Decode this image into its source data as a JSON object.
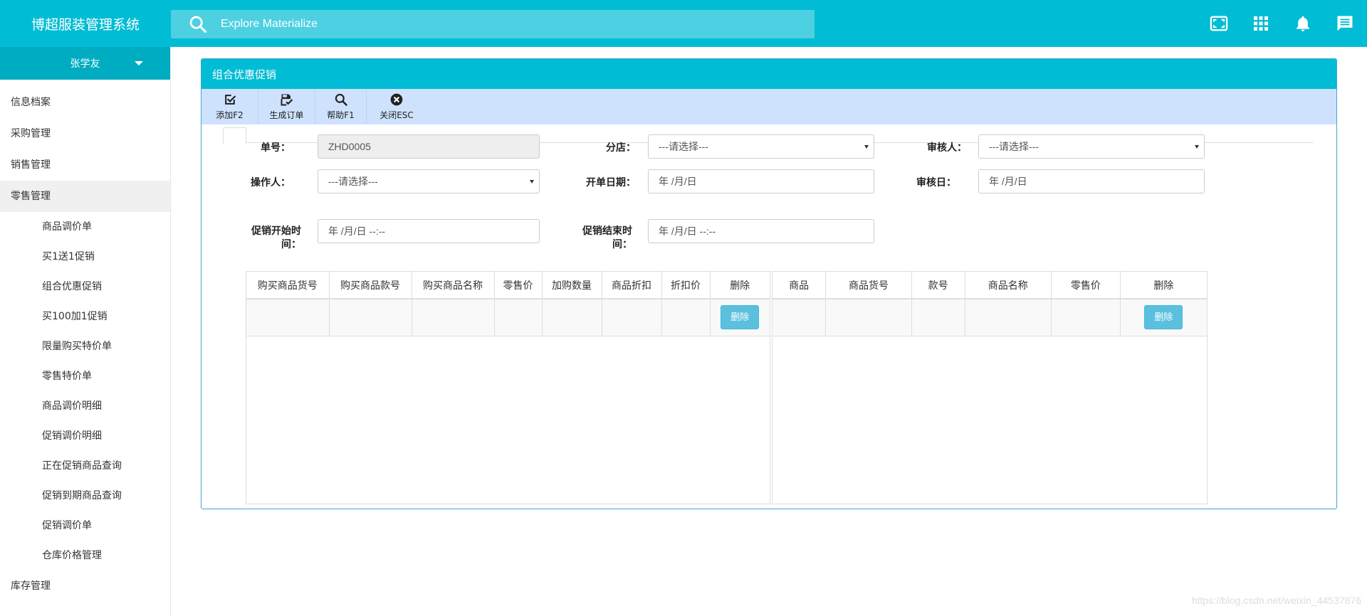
{
  "app": {
    "title": "博超服装管理系统",
    "search_placeholder": "Explore Materialize",
    "top_icons": [
      "fullscreen-icon",
      "apps-grid-icon",
      "notifications-bell-icon",
      "chat-message-icon"
    ]
  },
  "sidebar": {
    "user": "张学友",
    "nav": [
      {
        "label": "信息档案"
      },
      {
        "label": "采购管理"
      },
      {
        "label": "销售管理"
      },
      {
        "label": "零售管理"
      }
    ],
    "sub": [
      {
        "label": "商品调价单"
      },
      {
        "label": "买1送1促销"
      },
      {
        "label": "组合优惠促销"
      },
      {
        "label": "买100加1促销"
      },
      {
        "label": "限量购买特价单"
      },
      {
        "label": "零售特价单"
      },
      {
        "label": "商品调价明细"
      },
      {
        "label": "促销调价明细"
      },
      {
        "label": "正在促销商品查询"
      },
      {
        "label": "促销到期商品查询"
      },
      {
        "label": "促销调价单"
      },
      {
        "label": "仓库价格管理"
      }
    ],
    "after": [
      {
        "label": "库存管理"
      }
    ]
  },
  "panel": {
    "title": "组合优惠促销",
    "toolbar": [
      {
        "label": "添加F2",
        "icon": "check-square-icon"
      },
      {
        "label": "生成订单",
        "icon": "save-check-icon"
      },
      {
        "label": "帮助F1",
        "icon": "search-icon"
      },
      {
        "label": "关闭ESC",
        "icon": "close-circle-icon"
      }
    ]
  },
  "form": {
    "order_no_label": "单号：",
    "order_no_value": "ZHD0005",
    "branch_label": "分店：",
    "branch_value": "---请选择---",
    "reviewer_label": "审核人：",
    "reviewer_value": "---请选择---",
    "operator_label": "操作人：",
    "operator_value": "---请选择---",
    "open_date_label": "开单日期：",
    "open_date_value": "年 /月/日",
    "review_date_label": "审核日：",
    "review_date_value": "年 /月/日",
    "promo_start_label": "促销开始时间：",
    "promo_start_value": "年 /月/日 --:--",
    "promo_end_label": "促销结束时间：",
    "promo_end_value": "年 /月/日 --:--"
  },
  "left_table": {
    "headers": [
      "购买商品货号",
      "购买商品款号",
      "购买商品名称",
      "零售价",
      "加购数量",
      "商品折扣",
      "折扣价",
      "删除"
    ],
    "row": [
      "",
      "",
      "",
      "",
      "",
      "",
      "",
      "删除"
    ]
  },
  "right_table": {
    "headers": [
      "商品",
      "商品货号",
      "款号",
      "商品名称",
      "零售价",
      "删除"
    ],
    "row": [
      "",
      "",
      "",
      "",
      "",
      "删除"
    ]
  },
  "watermark": "https://blog.csdn.net/weixin_44537876"
}
